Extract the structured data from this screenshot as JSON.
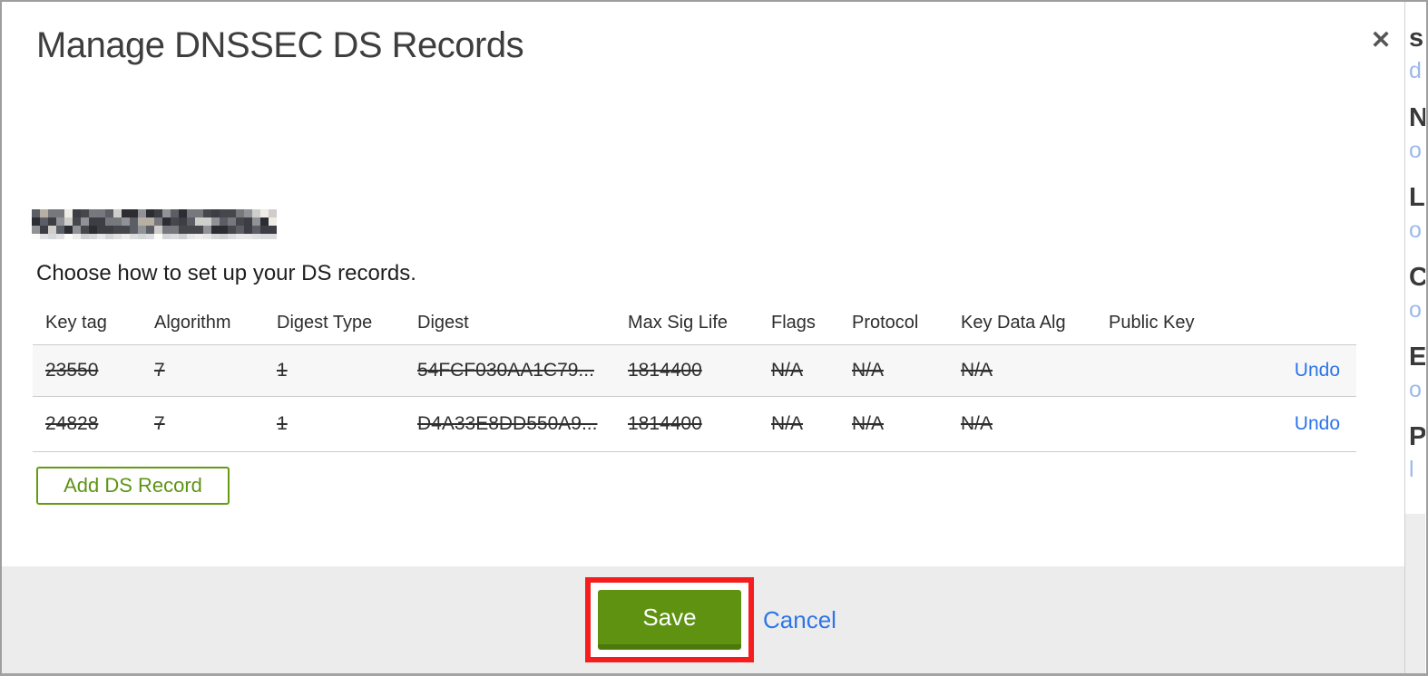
{
  "modal": {
    "title": "Manage DNSSEC DS Records",
    "close_glyph": "✕",
    "instruction": "Choose how to set up your DS records.",
    "add_button_label": "Add DS Record"
  },
  "table": {
    "columns": [
      "Key tag",
      "Algorithm",
      "Digest Type",
      "Digest",
      "Max Sig Life",
      "Flags",
      "Protocol",
      "Key Data Alg",
      "Public Key",
      ""
    ],
    "rows": [
      {
        "cells": [
          "23550",
          "7",
          "1",
          "54FCF030AA1C79...",
          "1814400",
          "N/A",
          "N/A",
          "N/A",
          ""
        ],
        "struck": true,
        "action": "Undo"
      },
      {
        "cells": [
          "24828",
          "7",
          "1",
          "D4A33E8DD550A9...",
          "1814400",
          "N/A",
          "N/A",
          "N/A",
          ""
        ],
        "struck": true,
        "action": "Undo"
      }
    ]
  },
  "footer": {
    "save_label": "Save",
    "cancel_label": "Cancel"
  },
  "colors": {
    "link_blue": "#2d75e8",
    "action_green": "#5e9210",
    "green_border": "#649b10",
    "annotation_red": "#f51d1d",
    "footer_gray": "#ececec",
    "row_stripe": "#f7f7f7",
    "redacted_palette": [
      "#2b2d33",
      "#45474d",
      "#5c5e66",
      "#76787e",
      "#909298",
      "#3c3e44",
      "#cfcecb",
      "#efece6",
      "#b7afa2",
      "#57575e",
      "#242529",
      "#84868c"
    ]
  },
  "background_strip": {
    "dark_letters": [
      "s",
      "N",
      "L",
      "C",
      "E",
      "P"
    ],
    "link_fragments": [
      "d",
      "o",
      "o",
      "o",
      "o",
      "l"
    ]
  }
}
